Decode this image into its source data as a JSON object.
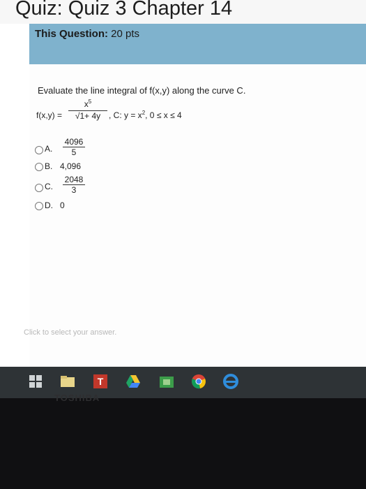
{
  "header": {
    "title": "Quiz: Quiz 3 Chapter 14"
  },
  "points": {
    "label": "This Question:",
    "value": "20 pts"
  },
  "question": {
    "prompt": "Evaluate the line integral of f(x,y) along the curve C.",
    "f_label": "f(x,y) =",
    "numerator": "x",
    "numerator_exp": "5",
    "denominator": "√1+ 4y",
    "curve_label": ", C: y = x",
    "curve_exp": "2",
    "range": ",  0 ≤ x ≤ 4"
  },
  "options": [
    {
      "letter": "A.",
      "numerator": "4096",
      "denominator": "5"
    },
    {
      "letter": "B.",
      "text": "4,096"
    },
    {
      "letter": "C.",
      "numerator": "2048",
      "denominator": "3"
    },
    {
      "letter": "D.",
      "text": "0"
    }
  ],
  "hint": "Click to select your answer.",
  "taskbar": {
    "icons": [
      "windows-start-icon",
      "file-explorer-icon",
      "t-app-icon",
      "drive-icon",
      "store-icon",
      "chrome-icon",
      "internet-explorer-icon"
    ]
  },
  "bezel": {
    "brand": "TOSHIBA"
  }
}
